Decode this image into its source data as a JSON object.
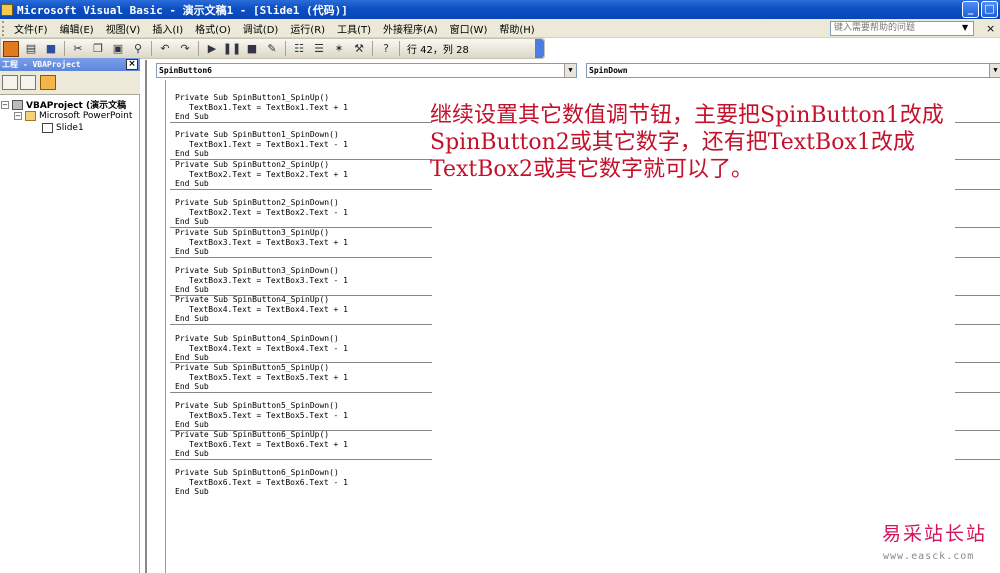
{
  "window": {
    "title": "Microsoft Visual Basic - 演示文稿1 - [Slide1 (代码)]"
  },
  "menu": {
    "items": [
      "文件(F)",
      "编辑(E)",
      "视图(V)",
      "插入(I)",
      "格式(O)",
      "调试(D)",
      "运行(R)",
      "工具(T)",
      "外接程序(A)",
      "窗口(W)",
      "帮助(H)"
    ],
    "help_placeholder": "键入需要帮助的问题",
    "close_glyph": "×"
  },
  "toolbar": {
    "position_text": "行 42，列 28"
  },
  "project": {
    "title": "工程 - VBAProject",
    "tree": [
      {
        "label": "VBAProject (演示文稿"
      },
      {
        "label": "Microsoft PowerPoint"
      },
      {
        "label": "Slide1"
      }
    ]
  },
  "editor": {
    "object_combo": "SpinButton6",
    "proc_combo": "SpinDown",
    "procedures": [
      {
        "sig": "Private Sub SpinButton1_SpinUp()",
        "body": "TextBox1.Text = TextBox1.Text + 1",
        "end": "End Sub"
      },
      {
        "sig": "Private Sub SpinButton1_SpinDown()",
        "body": "TextBox1.Text = TextBox1.Text - 1",
        "end": "End Sub"
      },
      {
        "sig": "Private Sub SpinButton2_SpinUp()",
        "body": "TextBox2.Text = TextBox2.Text + 1",
        "end": "End Sub"
      },
      {
        "sig": "Private Sub SpinButton2_SpinDown()",
        "body": "TextBox2.Text = TextBox2.Text - 1",
        "end": "End Sub"
      },
      {
        "sig": "Private Sub SpinButton3_SpinUp()",
        "body": "TextBox3.Text = TextBox3.Text + 1",
        "end": "End Sub"
      },
      {
        "sig": "Private Sub SpinButton3_SpinDown()",
        "body": "TextBox3.Text = TextBox3.Text - 1",
        "end": "End Sub"
      },
      {
        "sig": "Private Sub SpinButton4_SpinUp()",
        "body": "TextBox4.Text = TextBox4.Text + 1",
        "end": "End Sub"
      },
      {
        "sig": "Private Sub SpinButton4_SpinDown()",
        "body": "TextBox4.Text = TextBox4.Text - 1",
        "end": "End Sub"
      },
      {
        "sig": "Private Sub SpinButton5_SpinUp()",
        "body": "TextBox5.Text = TextBox5.Text + 1",
        "end": "End Sub"
      },
      {
        "sig": "Private Sub SpinButton5_SpinDown()",
        "body": "TextBox5.Text = TextBox5.Text - 1",
        "end": "End Sub"
      },
      {
        "sig": "Private Sub SpinButton6_SpinUp()",
        "body": "TextBox6.Text = TextBox6.Text + 1",
        "end": "End Sub"
      },
      {
        "sig": "Private Sub SpinButton6_SpinDown()",
        "body": "TextBox6.Text = TextBox6.Text - 1",
        "end": "End Sub"
      }
    ]
  },
  "annotation": "继续设置其它数值调节钮，主要把SpinButton1改成SpinButton2或其它数字，还有把TextBox1改成TextBox2或其它数字就可以了。",
  "watermark": {
    "name": "易采站长站",
    "url": "www.easck.com"
  }
}
